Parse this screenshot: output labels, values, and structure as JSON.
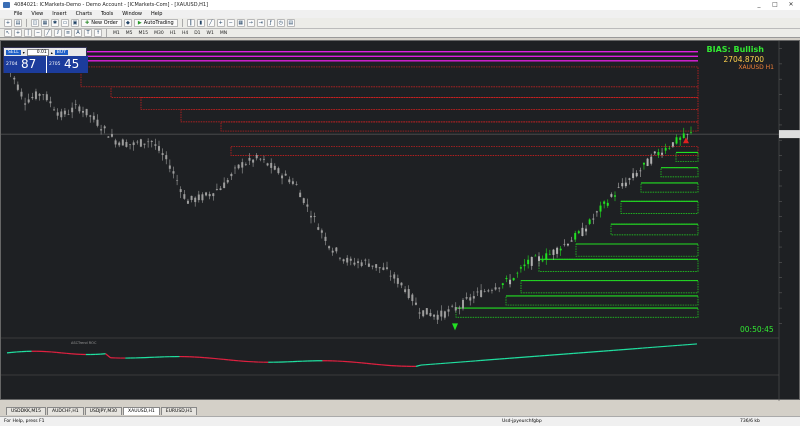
{
  "window": {
    "title": "4084021: ICMarkets-Demo - Demo Account - [ICMarkets-Com] - [XAUUSD,H1]",
    "minimize": "_",
    "maximize": "□",
    "close": "✕"
  },
  "menu": [
    "File",
    "View",
    "Insert",
    "Charts",
    "Tools",
    "Window",
    "Help"
  ],
  "toolbar": {
    "new_order": "New Order",
    "autotrading": "AutoTrading",
    "timeframes": [
      "M1",
      "M5",
      "M15",
      "M30",
      "H1",
      "H4",
      "D1",
      "W1",
      "MN"
    ]
  },
  "trade_panel": {
    "sell_label": "SELL",
    "buy_label": "BUY",
    "lot": "0.01",
    "sell_small": "2704",
    "sell_big": "87",
    "buy_small": "2705",
    "buy_big": "45"
  },
  "overlay": {
    "bias": "BIAS: Bullish",
    "bias_price": "2704.8700",
    "symbol_tf": "XAUUSD  H1",
    "timer": "00:50:45"
  },
  "colors": {
    "background": "#1e2023",
    "bull_candle": "#9e9e9e",
    "resistance": "#e02020",
    "support": "#22e022",
    "magenta": "#e020e0",
    "bias_green": "#32e832"
  },
  "indicator": {
    "label": "ASCTrend ROC"
  },
  "tabs": [
    {
      "label": "USDDKK,M15",
      "active": false
    },
    {
      "label": "AUDCHF,H1",
      "active": false
    },
    {
      "label": "USDJPY,M30",
      "active": false
    },
    {
      "label": "XAUUSD,H1",
      "active": true
    },
    {
      "label": "EURUSD,H1",
      "active": false
    }
  ],
  "status": {
    "help": "For Help, press F1",
    "profile": "Usd-jpyeurchfgbp",
    "traffic": "736/6 kb"
  },
  "chart_data": {
    "type": "candlestick",
    "symbol": "XAUUSD",
    "timeframe": "H1",
    "trend_path_y_price": [
      2750,
      2726,
      2731,
      2716,
      2722,
      2712,
      2700,
      2697,
      2700,
      2685,
      2660,
      2663,
      2670,
      2684,
      2688,
      2680,
      2672,
      2650,
      2630,
      2620,
      2620,
      2615,
      2605,
      2588,
      2585,
      2590,
      2598,
      2604,
      2608,
      2620,
      2624,
      2632,
      2640,
      2655,
      2668,
      2678,
      2690,
      2698,
      2704
    ],
    "last_price": 2704.87
  }
}
